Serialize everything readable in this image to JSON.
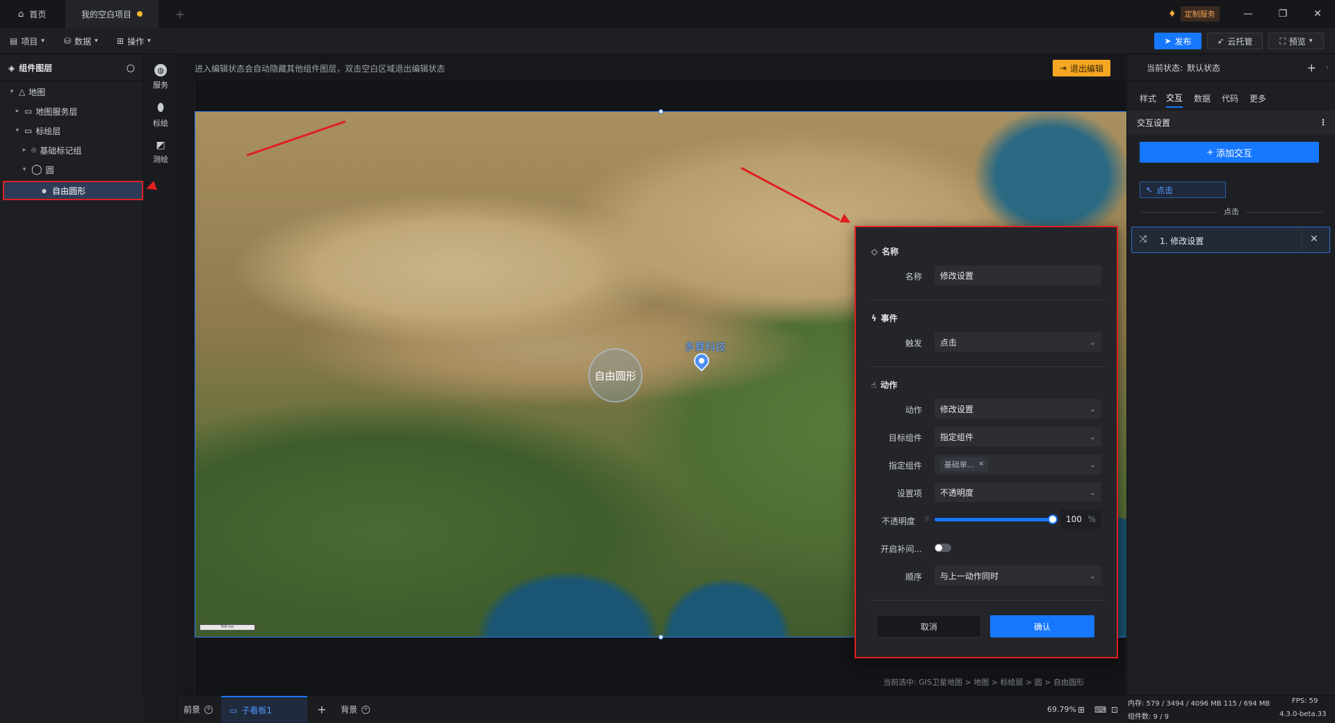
{
  "titlebar": {
    "home_tab": "首页",
    "project_tab": "我的空白项目",
    "new_tab": "+",
    "custom_service": "定制服务"
  },
  "toolbar": {
    "menu_project": "项目",
    "menu_data": "数据",
    "menu_ops": "操作",
    "publish": "发布",
    "cloud": "云托管",
    "preview": "预览"
  },
  "layers": {
    "title": "组件图层",
    "items": [
      {
        "label": "地图"
      },
      {
        "label": "地图服务层"
      },
      {
        "label": "标绘层"
      },
      {
        "label": "基础标记组"
      },
      {
        "label": "圆"
      },
      {
        "label": "自由圆形"
      }
    ]
  },
  "strip": {
    "service": "服务",
    "mark": "标绘",
    "measure": "测绘"
  },
  "canvas": {
    "notice": "进入编辑状态会自动隐藏其他组件图层，双击空白区域退出编辑状态",
    "exit_edit": "退出编辑",
    "circle_label": "自由圆形",
    "pin_label": "多算科技",
    "scale": "500 km",
    "breadcrumb": "当前选中: GIS卫星地图 > 地图 > 标绘层 > 圆 > 自由圆形"
  },
  "popup": {
    "name_section": "名称",
    "name_label": "名称",
    "name_value": "修改设置",
    "event_section": "事件",
    "trigger_label": "触发",
    "trigger_value": "点击",
    "action_section": "动作",
    "action_label": "动作",
    "action_value": "修改设置",
    "target_label": "目标组件",
    "target_value": "指定组件",
    "specify_label": "指定组件",
    "specify_tag": "基础单...",
    "setting_label": "设置项",
    "setting_value": "不透明度",
    "opacity_label": "不透明度",
    "opacity_value": "100",
    "opacity_unit": "%",
    "tween_label": "开启补间...",
    "order_label": "顺序",
    "order_value": "与上一动作同时",
    "cancel": "取消",
    "confirm": "确认"
  },
  "rightpanel": {
    "state_label": "当前状态:",
    "state_value": "默认状态",
    "tabs": [
      "样式",
      "交互",
      "数据",
      "代码",
      "更多"
    ],
    "section": "交互设置",
    "add_interaction": "添加交互",
    "click_chip": "点击",
    "click_sep": "点击",
    "action_item": "1. 修改设置"
  },
  "bottombar": {
    "front": "前景",
    "sub_board": "子看板1",
    "back": "背景",
    "zoom": "69.79%",
    "memory": "内存: 579 / 3494 / 4096 MB  115 / 694 MB",
    "fps": "FPS: 59",
    "components": "组件数: 9 / 9",
    "version": "4.3.0-beta.33"
  }
}
